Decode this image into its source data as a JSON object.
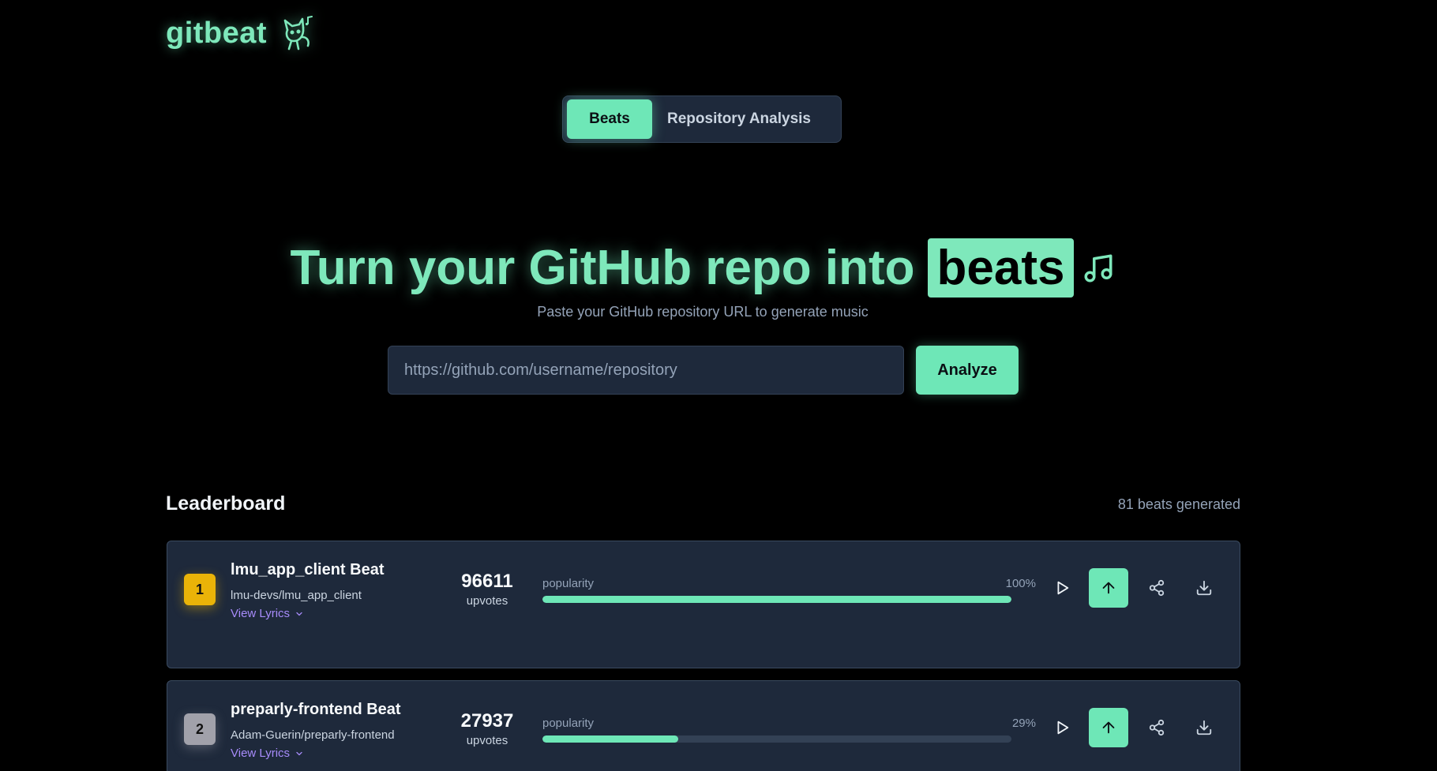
{
  "header": {
    "logo_text": "gitbeat"
  },
  "tabs": [
    {
      "label": "Beats",
      "active": true
    },
    {
      "label": "Repository Analysis",
      "active": false
    }
  ],
  "hero": {
    "title_prefix": "Turn your GitHub repo into",
    "title_highlight": "beats",
    "subtitle": "Paste your GitHub repository URL to generate music"
  },
  "search": {
    "placeholder": "https://github.com/username/repository",
    "value": "",
    "button_label": "Analyze"
  },
  "leaderboard": {
    "title": "Leaderboard",
    "count_text": "81 beats generated",
    "entries": [
      {
        "rank": "1",
        "name": "lmu_app_client Beat",
        "repo": "lmu-devs/lmu_app_client",
        "lyrics_label": "View Lyrics",
        "upvotes": "96611",
        "upvotes_label": "upvotes",
        "popularity_label": "popularity",
        "popularity_pct": "100%",
        "popularity": 1.0
      },
      {
        "rank": "2",
        "name": "preparly-frontend Beat",
        "repo": "Adam-Guerin/preparly-frontend",
        "lyrics_label": "View Lyrics",
        "upvotes": "27937",
        "upvotes_label": "upvotes",
        "popularity_label": "popularity",
        "popularity_pct": "29%",
        "popularity": 0.29
      }
    ]
  },
  "icons": {
    "logo": "cat-music-icon",
    "note": "music-note-icon",
    "play": "play-icon",
    "upvote": "arrow-up-icon",
    "share": "share-icon",
    "download": "download-icon",
    "chevron": "chevron-down-icon"
  },
  "colors": {
    "accent": "#6ee7b7",
    "background": "#000000",
    "card": "#1e293b",
    "gold": "#eab308",
    "silver": "#a1a1aa",
    "link": "#a78bfa"
  }
}
